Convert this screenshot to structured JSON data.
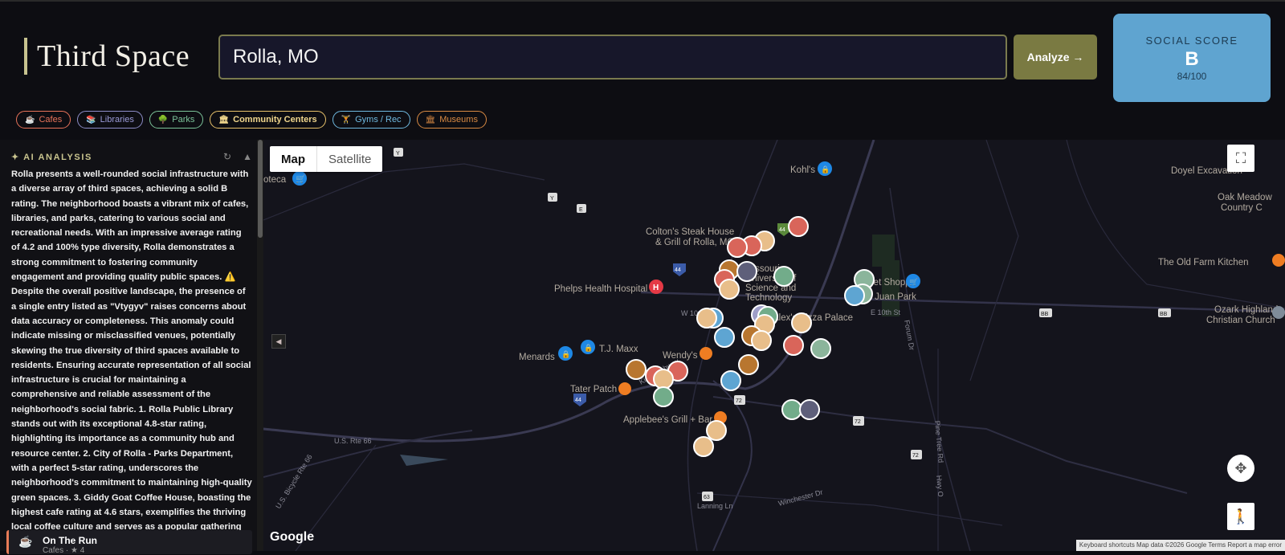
{
  "header": {
    "title": "Third Space",
    "search_value": "Rolla, MO",
    "analyze_label": "Analyze →",
    "score_label": "SOCIAL SCORE",
    "score_grade": "B",
    "score_value": "84/100"
  },
  "chips": [
    {
      "label": "Cafes",
      "icon": "coffee-icon",
      "color": "#e8735a"
    },
    {
      "label": "Libraries",
      "icon": "books-icon",
      "color": "#9b9bd8"
    },
    {
      "label": "Parks",
      "icon": "tree-icon",
      "color": "#7cc49a"
    },
    {
      "label": "Community Centers",
      "icon": "building-icon",
      "color": "#e8c26b"
    },
    {
      "label": "Gyms / Rec",
      "icon": "dumbbell-icon",
      "color": "#6fb9e0"
    },
    {
      "label": "Museums",
      "icon": "museum-icon",
      "color": "#d98a43"
    }
  ],
  "sidebar": {
    "ai_title": "✦ AI ANALYSIS",
    "ai_text": "Rolla presents a well-rounded social infrastructure with a diverse array of third spaces, achieving a solid B rating. The neighborhood boasts a vibrant mix of cafes, libraries, and parks, catering to various social and recreational needs. With an impressive average rating of 4.2 and 100% type diversity, Rolla demonstrates a strong commitment to fostering community engagement and providing quality public spaces. ⚠️ Despite the overall positive landscape, the presence of a single entry listed as \"Vtygyv\" raises concerns about data accuracy or completeness. This anomaly could indicate missing or misclassified venues, potentially skewing the true diversity of third spaces available to residents. Ensuring accurate representation of all social infrastructure is crucial for maintaining a comprehensive and reliable assessment of the neighborhood's social fabric. 1. Rolla Public Library stands out with its exceptional 4.8-star rating, highlighting its importance as a community hub and resource center. 2. City of Rolla - Parks Department, with a perfect 5-star rating, underscores the neighborhood's commitment to maintaining high-quality green spaces. 3. Giddy Goat Coffee House, boasting the highest cafe rating at 4.6 stars, exemplifies the thriving local coffee culture and serves as a popular gathering spot for residents.",
    "first_item": {
      "name": "On The Run",
      "meta": "Cafes · ★ 4"
    }
  },
  "map": {
    "type_map": "Map",
    "type_satellite": "Satellite",
    "google": "Google",
    "attribution": "Keyboard shortcuts   Map data ©2026 Google   Terms   Report a map error",
    "places": [
      "Colton's Steak House",
      "& Grill of Rolla, MO",
      "Phelps Health Hospital",
      "Missouri",
      "University of",
      "Science and",
      "Technology",
      "Alex's Pizza Palace",
      "Wendy's",
      "T.J. Maxx",
      "Menards",
      "Tater Patch",
      "Applebee's Grill + Bar",
      "Kohl's",
      "Doyel Excavation",
      "Oak Meadow",
      "Country C",
      "The Old Farm Kitchen",
      "Ozark Highlands",
      "Christian Church",
      "Ber Juan Park",
      "Pet Shopper",
      "oteca"
    ],
    "roads": [
      "W 10th St",
      "E 10th St",
      "U.S. Rte 66",
      "U.S. Bicycle Rte 66",
      "Forum Dr",
      "Pine Tree Rd",
      "Hwy O",
      "Winchester Dr",
      "Lanning Ln",
      "Kingshighway"
    ],
    "shields": [
      "44",
      "72",
      "63",
      "BB",
      "Y",
      "E"
    ]
  }
}
